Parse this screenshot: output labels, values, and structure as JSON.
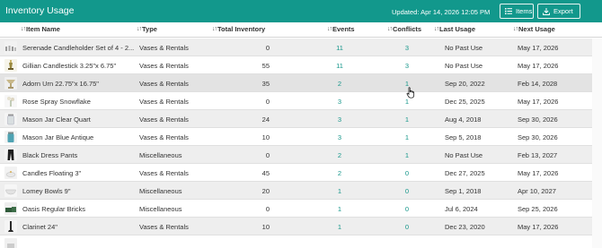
{
  "header": {
    "title": "Inventory Usage",
    "updated": "Updated: Apr 14, 2026 12:05 PM",
    "items_button": "Items",
    "export_button": "Export",
    "bg_color": "#12988c"
  },
  "columns": {
    "item_name": "Item Name",
    "type": "Type",
    "total_inventory": "Total Inventory",
    "events": "Events",
    "conflicts": "Conflicts",
    "last_usage": "Last Usage",
    "next_usage": "Next Usage",
    "sort_icon": "↓↑"
  },
  "rows": [
    {
      "name": "Serenade Candleholder Set of 4 - 2...",
      "type": "Vases & Rentals",
      "total": "0",
      "events": "11",
      "conflicts": "3",
      "last": "No Past Use",
      "next": "May 17, 2026",
      "thumb": "candleholder-set"
    },
    {
      "name": "Gillian Candlestick 3.25\"x 6.75\"",
      "type": "Vases & Rentals",
      "total": "55",
      "events": "11",
      "conflicts": "3",
      "last": "No Past Use",
      "next": "May 17, 2026",
      "thumb": "candlestick"
    },
    {
      "name": "Adorn Urn 22.75\"x 16.75\"",
      "type": "Vases & Rentals",
      "total": "35",
      "events": "2",
      "conflicts": "1",
      "last": "Sep 20, 2022",
      "next": "Feb 14, 2028",
      "thumb": "urn"
    },
    {
      "name": "Rose Spray Snowflake",
      "type": "Vases & Rentals",
      "total": "0",
      "events": "3",
      "conflicts": "1",
      "last": "Dec 25, 2025",
      "next": "May 17, 2026",
      "thumb": "rose-spray"
    },
    {
      "name": "Mason Jar Clear Quart",
      "type": "Vases & Rentals",
      "total": "24",
      "events": "3",
      "conflicts": "1",
      "last": "Aug 4, 2018",
      "next": "Sep 30, 2026",
      "thumb": "mason-jar-clear"
    },
    {
      "name": "Mason Jar Blue Antique",
      "type": "Vases & Rentals",
      "total": "10",
      "events": "3",
      "conflicts": "1",
      "last": "Sep 5, 2018",
      "next": "Sep 30, 2026",
      "thumb": "mason-jar-blue"
    },
    {
      "name": "Black Dress Pants",
      "type": "Miscellaneous",
      "total": "0",
      "events": "2",
      "conflicts": "1",
      "last": "No Past Use",
      "next": "Feb 13, 2027",
      "thumb": "dress-pants"
    },
    {
      "name": "Candles Floating 3\"",
      "type": "Vases & Rentals",
      "total": "45",
      "events": "2",
      "conflicts": "0",
      "last": "Dec 27, 2025",
      "next": "May 17, 2026",
      "thumb": "floating-candles"
    },
    {
      "name": "Lomey Bowls 9\"",
      "type": "Miscellaneous",
      "total": "20",
      "events": "1",
      "conflicts": "0",
      "last": "Sep 1, 2018",
      "next": "Apr 10, 2027",
      "thumb": "bowl"
    },
    {
      "name": "Oasis Regular Bricks",
      "type": "Miscellaneous",
      "total": "0",
      "events": "1",
      "conflicts": "0",
      "last": "Jul 6, 2024",
      "next": "Sep 25, 2026",
      "thumb": "bricks"
    },
    {
      "name": "Clarinet 24\"",
      "type": "Vases & Rentals",
      "total": "10",
      "events": "1",
      "conflicts": "0",
      "last": "Dec 23, 2020",
      "next": "May 17, 2026",
      "thumb": "clarinet"
    },
    {
      "name": "",
      "type": "",
      "total": "",
      "events": "",
      "conflicts": "",
      "last": "",
      "next": "",
      "thumb": "partial"
    }
  ]
}
